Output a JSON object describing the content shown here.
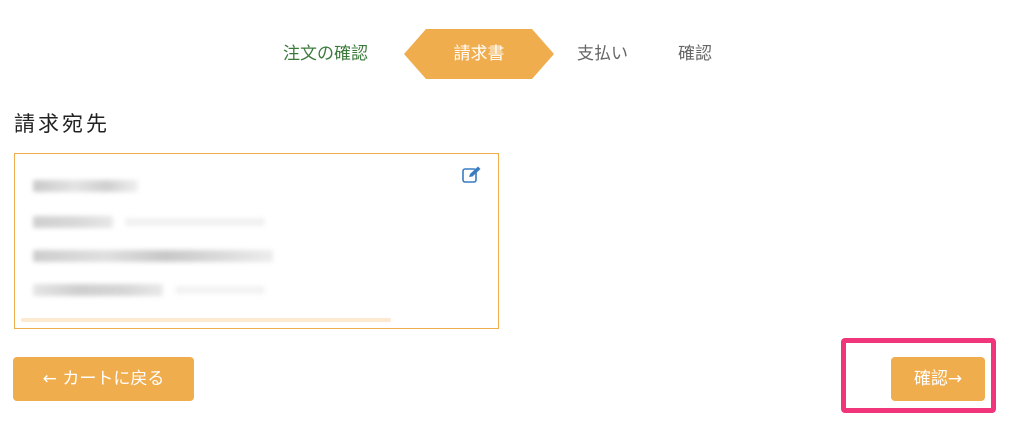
{
  "stepper": {
    "steps": [
      {
        "label": "注文の確認",
        "state": "done"
      },
      {
        "label": "請求書",
        "state": "active"
      },
      {
        "label": "支払い",
        "state": "pending"
      },
      {
        "label": "確認",
        "state": "pending"
      }
    ]
  },
  "billing": {
    "title": "請求宛先",
    "edit_icon": "edit-icon"
  },
  "actions": {
    "back_label": "← カートに戻る",
    "confirm_label": "確認→"
  },
  "colors": {
    "accent": "#f0ad4e",
    "done_step": "#3c7a3c",
    "highlight": "#f0357a"
  }
}
